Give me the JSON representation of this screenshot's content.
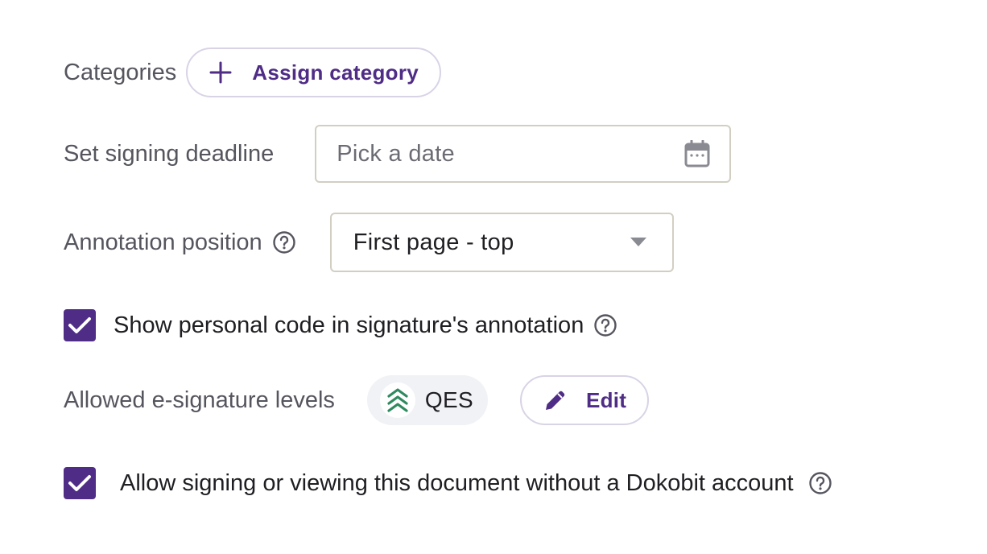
{
  "categories": {
    "label": "Categories",
    "assign_button_label": "Assign category"
  },
  "deadline": {
    "label": "Set signing deadline",
    "placeholder": "Pick a date"
  },
  "annotation": {
    "label": "Annotation position",
    "selected_value": "First page - top"
  },
  "personal_code": {
    "checked": true,
    "label": "Show personal code in signature's annotation"
  },
  "signature_levels": {
    "label": "Allowed e-signature levels",
    "level_badge": "QES",
    "edit_button_label": "Edit"
  },
  "no_account": {
    "checked": true,
    "label": "Allow signing or viewing this document without a Dokobit account"
  },
  "colors": {
    "accent": "#4f2d86",
    "badge_icon": "#2f8a5f",
    "field_border": "#d2cfc2",
    "pill_border": "#d9d3e6",
    "label_text": "#55555e"
  },
  "icons": {
    "add": "plus-icon",
    "calendar": "calendar-icon",
    "dropdown": "chevron-down-icon",
    "help": "question-circle-icon",
    "check": "check-icon",
    "level": "chevrons-up-icon",
    "edit": "pencil-icon"
  }
}
